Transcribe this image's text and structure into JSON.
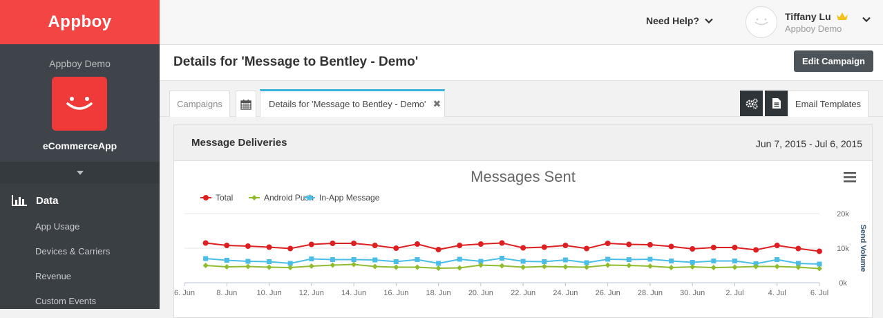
{
  "brand": {
    "logo_text": "Appboy"
  },
  "sidebar": {
    "company": "Appboy Demo",
    "app_name": "eCommerceApp",
    "section_label": "Data",
    "items": [
      "App Usage",
      "Devices & Carriers",
      "Revenue",
      "Custom Events"
    ]
  },
  "header": {
    "help_label": "Need Help?",
    "user_name": "Tiffany Lu",
    "user_org": "Appboy Demo"
  },
  "page": {
    "title": "Details for 'Message to Bentley - Demo'",
    "edit_button": "Edit Campaign"
  },
  "tabs": {
    "campaigns": "Campaigns",
    "details": "Details for 'Message to Bentley - Demo'",
    "email_templates": "Email Templates"
  },
  "card": {
    "title": "Message Deliveries",
    "date_range": "Jun 7, 2015 - Jul 6, 2015"
  },
  "colors": {
    "brand": "#f44545",
    "accent_tab": "#39b3de"
  },
  "chart_data": {
    "type": "line",
    "title": "Messages Sent",
    "ylabel": "Send Volume",
    "ylim": [
      0,
      20000
    ],
    "y_ticks": [
      "0k",
      "10k",
      "20k"
    ],
    "x_tick_labels": [
      "6. Jun",
      "8. Jun",
      "10. Jun",
      "12. Jun",
      "14. Jun",
      "16. Jun",
      "18. Jun",
      "20. Jun",
      "22. Jun",
      "24. Jun",
      "26. Jun",
      "28. Jun",
      "30. Jun",
      "2. Jul",
      "4. Jul",
      "6. Jul"
    ],
    "x": [
      "7 Jun",
      "8 Jun",
      "9 Jun",
      "10 Jun",
      "11 Jun",
      "12 Jun",
      "13 Jun",
      "14 Jun",
      "15 Jun",
      "16 Jun",
      "17 Jun",
      "18 Jun",
      "19 Jun",
      "20 Jun",
      "21 Jun",
      "22 Jun",
      "23 Jun",
      "24 Jun",
      "25 Jun",
      "26 Jun",
      "27 Jun",
      "28 Jun",
      "29 Jun",
      "30 Jun",
      "1 Jul",
      "2 Jul",
      "3 Jul",
      "4 Jul",
      "5 Jul",
      "6 Jul"
    ],
    "legend_position": "top-left",
    "series": [
      {
        "name": "Total",
        "color": "#dd1f22",
        "marker": "circle",
        "values": [
          11500,
          10800,
          10600,
          10300,
          9900,
          11100,
          11400,
          11400,
          10800,
          10000,
          11200,
          9600,
          10800,
          11200,
          11500,
          10100,
          10300,
          10800,
          9900,
          11400,
          11100,
          11000,
          10500,
          9800,
          10200,
          10200,
          9500,
          10800,
          9900,
          9100
        ]
      },
      {
        "name": "Android Push",
        "color": "#8fbc2f",
        "marker": "diamond",
        "values": [
          5000,
          4600,
          4700,
          4500,
          4400,
          4800,
          5100,
          5300,
          4700,
          4500,
          4500,
          4200,
          4300,
          5100,
          4900,
          4500,
          4700,
          4600,
          4500,
          5100,
          5000,
          4800,
          4400,
          4600,
          4400,
          4500,
          4700,
          4700,
          4500,
          4100
        ]
      },
      {
        "name": "In-App Message",
        "color": "#4bbde9",
        "marker": "square",
        "values": [
          7000,
          6500,
          6200,
          6100,
          5600,
          6900,
          6700,
          6700,
          6600,
          6100,
          6700,
          5600,
          6800,
          6200,
          7100,
          6200,
          6100,
          6600,
          5800,
          6800,
          6700,
          6800,
          6300,
          5900,
          6300,
          6300,
          5500,
          6700,
          5600,
          5400
        ]
      }
    ]
  }
}
